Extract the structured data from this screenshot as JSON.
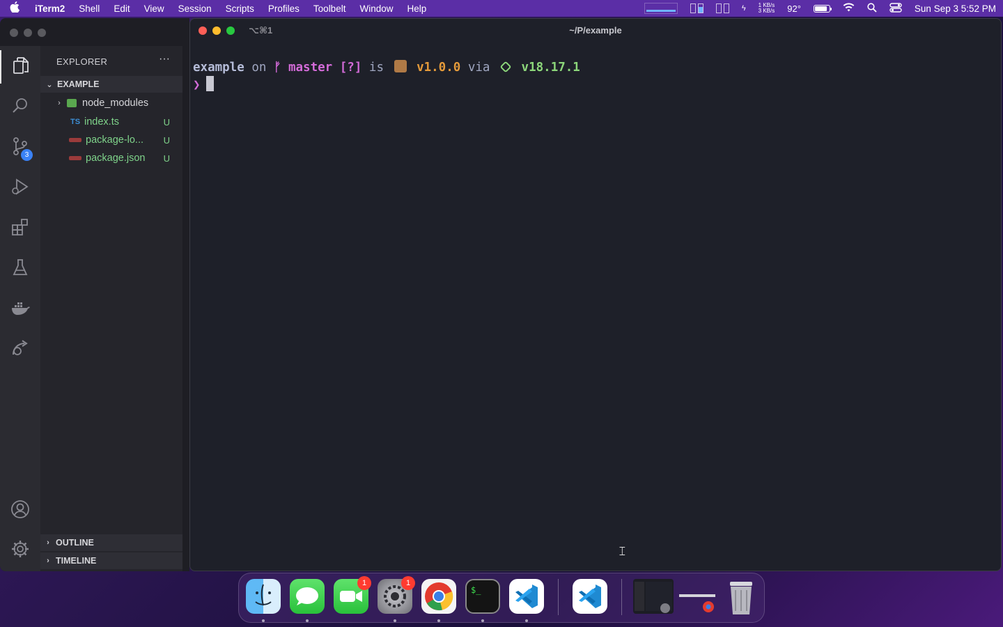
{
  "menubar": {
    "app_name": "iTerm2",
    "menus": [
      "Shell",
      "Edit",
      "View",
      "Session",
      "Scripts",
      "Profiles",
      "Toolbelt",
      "Window",
      "Help"
    ],
    "network_up": "1 KB/s",
    "network_down": "3 KB/s",
    "temperature": "92°",
    "datetime": "Sun Sep 3  5:52 PM"
  },
  "vscode": {
    "explorer_title": "EXPLORER",
    "more": "···",
    "folder_name": "EXAMPLE",
    "scm_badge": "3",
    "files": [
      {
        "name": "node_modules",
        "type": "folder",
        "status": ""
      },
      {
        "name": "index.ts",
        "type": "ts",
        "icon_text": "TS",
        "status": "U"
      },
      {
        "name": "package-lo...",
        "type": "json",
        "status": "U"
      },
      {
        "name": "package.json",
        "type": "json",
        "status": "U"
      }
    ],
    "outline_label": "OUTLINE",
    "timeline_label": "TIMELINE"
  },
  "iterm": {
    "tab_hint": "⌥⌘1",
    "window_title": "~/P/example",
    "prompt": {
      "dir": "example",
      "on": "on",
      "git_icon": "",
      "branch": "master",
      "git_status": "[?]",
      "is": "is",
      "version": "v1.0.0",
      "via": "via",
      "node_version": "v18.17.1",
      "arrow": "❯"
    }
  },
  "dock": {
    "apps": [
      "finder",
      "messages",
      "facetime",
      "system-settings",
      "chrome",
      "terminal",
      "vscode",
      "vscode-insiders",
      "iterm-preview",
      "chrome-window",
      "trash"
    ],
    "facetime_badge": "1",
    "settings_badge": "1"
  }
}
